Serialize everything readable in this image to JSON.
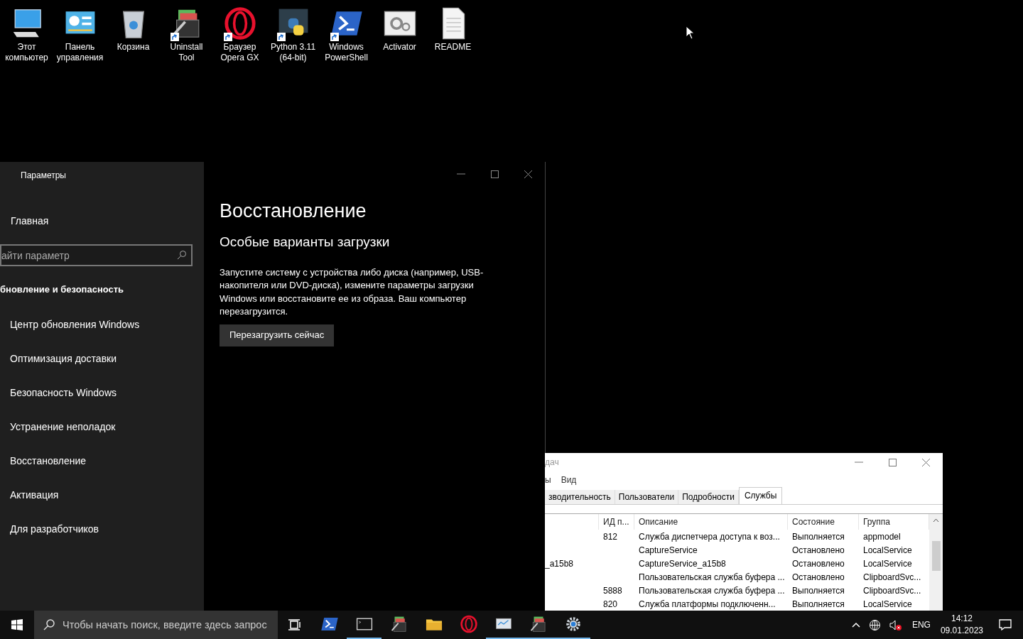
{
  "desktop_icons": [
    {
      "kind": "computer",
      "label": "Этот компьютер",
      "shortcut": false
    },
    {
      "kind": "control-panel",
      "label": "Панель управления",
      "shortcut": false
    },
    {
      "kind": "recycle-bin",
      "label": "Корзина",
      "shortcut": false
    },
    {
      "kind": "archive",
      "label": "Uninstall Tool",
      "shortcut": true
    },
    {
      "kind": "opera",
      "label": "Браузер Opera GX",
      "shortcut": true
    },
    {
      "kind": "python",
      "label": "Python 3.11 (64-bit)",
      "shortcut": true
    },
    {
      "kind": "powershell",
      "label": "Windows PowerShell",
      "shortcut": true
    },
    {
      "kind": "gears",
      "label": "Activator",
      "shortcut": false
    },
    {
      "kind": "document",
      "label": "README",
      "shortcut": false
    }
  ],
  "settings": {
    "title": "Параметры",
    "home": "Главная",
    "search": {
      "placeholder": "айти параметр"
    },
    "section": "бновление и безопасность",
    "items": [
      "Центр обновления Windows",
      "Оптимизация доставки",
      "Безопасность Windows",
      "Устранение неполадок",
      "Восстановление",
      "Активация",
      "Для разработчиков"
    ],
    "page_title": "Восстановление",
    "heading": "Особые варианты загрузки",
    "description": "Запустите систему с устройства либо диска (например, USB-накопителя или DVD-диска), измените параметры загрузки Windows или восстановите ее из образа. Ваш компьютер перезагрузится.",
    "button": "Перезагрузить сейчас"
  },
  "task_manager": {
    "title": "дач",
    "menu": [
      "ы",
      "Вид"
    ],
    "tabs": [
      {
        "label": "зводительность",
        "selected": false
      },
      {
        "label": "Пользователи",
        "selected": false
      },
      {
        "label": "Подробности",
        "selected": false
      },
      {
        "label": "Службы",
        "selected": true
      }
    ],
    "columns": [
      "ИД п...",
      "Описание",
      "Состояние",
      "Группа"
    ],
    "rows": [
      {
        "pid": "812",
        "description": "Служба диспетчера доступа к воз...",
        "status": "Выполняется",
        "group": "appmodel"
      },
      {
        "description": "CaptureService",
        "status": "Остановлено",
        "group": "LocalService"
      },
      {
        "name": "_a15b8",
        "description": "CaptureService_a15b8",
        "status": "Остановлено",
        "group": "LocalService"
      },
      {
        "description": "Пользовательская служба буфера ...",
        "status": "Остановлено",
        "group": "ClipboardSvc..."
      },
      {
        "pid": "5888",
        "description": "Пользовательская служба буфера ...",
        "status": "Выполняется",
        "group": "ClipboardSvc..."
      },
      {
        "pid": "820",
        "description": "Служба платформы подключенн...",
        "status": "Выполняется",
        "group": "LocalService"
      }
    ]
  },
  "taskbar": {
    "search": {
      "placeholder": "Чтобы начать поиск, введите здесь запрос"
    },
    "apps": [
      {
        "kind": "powershell",
        "running": false
      },
      {
        "kind": "terminal",
        "running": true
      },
      {
        "kind": "archive",
        "running": false
      },
      {
        "kind": "folder",
        "running": false
      },
      {
        "kind": "opera",
        "running": false
      },
      {
        "kind": "monitor",
        "running": true
      },
      {
        "kind": "archive",
        "running": true
      },
      {
        "kind": "gear",
        "running": true
      }
    ],
    "language": "ENG",
    "time": "14:12",
    "date": "09.01.2023"
  }
}
